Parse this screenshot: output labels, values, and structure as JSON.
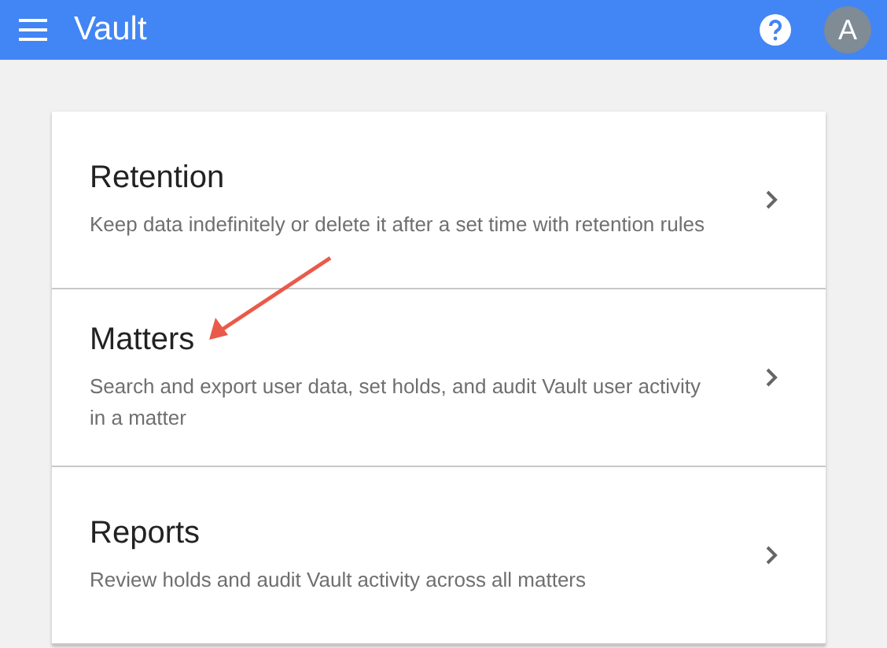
{
  "app_bar": {
    "title": "Vault",
    "avatar": "A"
  },
  "sections": [
    {
      "title": "Retention",
      "description": "Keep data indefinitely or delete it after a set time with retention rules",
      "annotated": false
    },
    {
      "title": "Matters",
      "description": "Search and export user data, set holds, and audit Vault user activity in a matter",
      "annotated": true
    },
    {
      "title": "Reports",
      "description": "Review holds and audit Vault activity across all matters",
      "annotated": false
    }
  ]
}
